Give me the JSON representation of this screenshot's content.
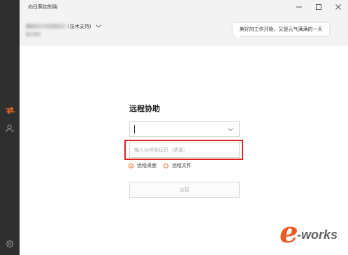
{
  "window": {
    "title": "向日葵控制端",
    "controls": {
      "minimize_icon": "minimize-icon",
      "maximize_icon": "maximize-icon",
      "close_icon": "close-icon"
    }
  },
  "sidebar": {
    "items": [
      {
        "icon": "swap-arrows-icon",
        "active": true
      },
      {
        "icon": "person-icon",
        "active": false
      }
    ],
    "bottom": {
      "icon": "gear-icon"
    }
  },
  "header": {
    "user_role": "(技术支持)",
    "user_menu_icon": "chevron-down-icon",
    "greeting": "美好的工作开始，又是元气满满的一天"
  },
  "main": {
    "title": "远程协助",
    "partner_id": {
      "value": "",
      "dropdown_icon": "chevron-down-icon"
    },
    "verification_code": {
      "placeholder": "输入伙伴验证码（选填）"
    },
    "mode_options": [
      {
        "label": "远程桌面",
        "selected": true
      },
      {
        "label": "远程文件",
        "selected": false
      }
    ],
    "connect_button": {
      "label": "连接",
      "enabled": false
    }
  },
  "colors": {
    "accent": "#f26b1f",
    "sidebar_bg": "#2f2f2f",
    "highlight_box": "#e0201d"
  },
  "watermark": {
    "text": "e-works"
  }
}
